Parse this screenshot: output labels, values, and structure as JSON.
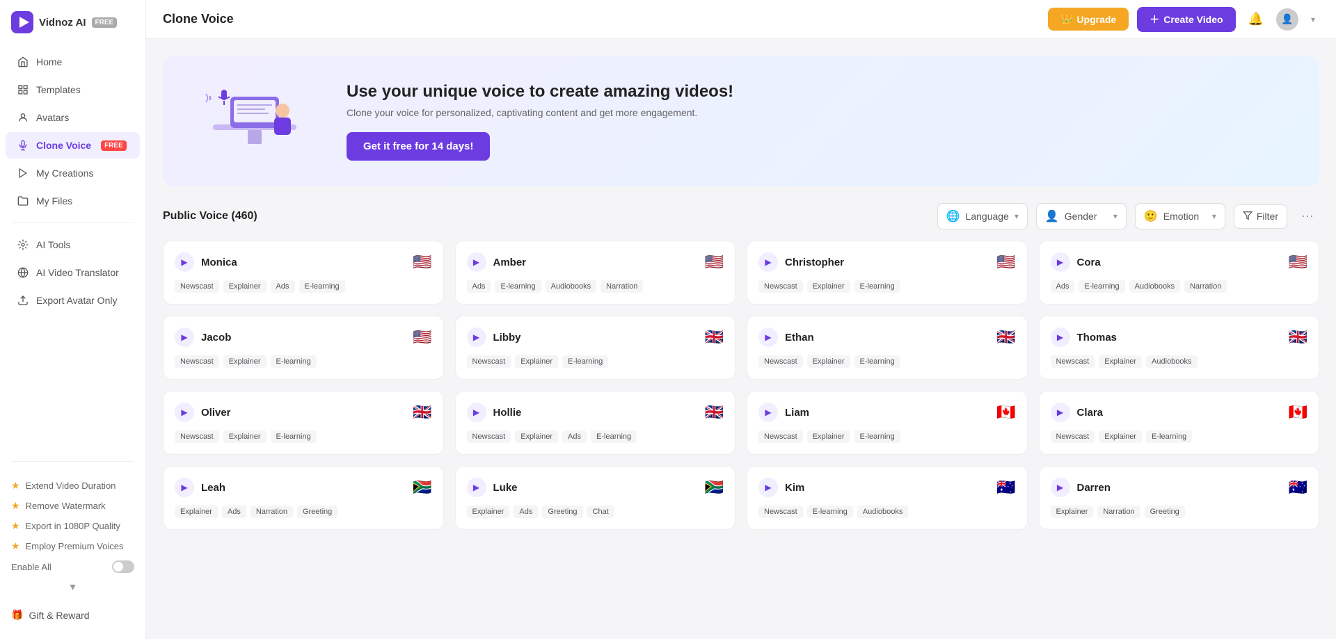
{
  "app": {
    "name": "Vidnoz AI",
    "badge": "FREE"
  },
  "topbar": {
    "title": "Clone Voice",
    "upgrade_label": "Upgrade",
    "create_label": "Create Video"
  },
  "sidebar": {
    "nav_items": [
      {
        "id": "home",
        "label": "Home",
        "icon": "home-icon",
        "active": false
      },
      {
        "id": "templates",
        "label": "Templates",
        "icon": "templates-icon",
        "active": false
      },
      {
        "id": "avatars",
        "label": "Avatars",
        "icon": "avatars-icon",
        "active": false
      },
      {
        "id": "clone-voice",
        "label": "Clone Voice",
        "icon": "clone-voice-icon",
        "active": true,
        "badge": "FREE"
      },
      {
        "id": "my-creations",
        "label": "My Creations",
        "icon": "creations-icon",
        "active": false
      },
      {
        "id": "my-files",
        "label": "My Files",
        "icon": "files-icon",
        "active": false
      }
    ],
    "tools_items": [
      {
        "id": "ai-tools",
        "label": "AI Tools",
        "icon": "ai-tools-icon"
      },
      {
        "id": "ai-video-translator",
        "label": "AI Video Translator",
        "icon": "translate-icon"
      },
      {
        "id": "export-avatar-only",
        "label": "Export Avatar Only",
        "icon": "export-icon"
      }
    ],
    "upgrade_items": [
      {
        "id": "extend-video",
        "label": "Extend Video Duration"
      },
      {
        "id": "remove-watermark",
        "label": "Remove Watermark"
      },
      {
        "id": "export-1080p",
        "label": "Export in 1080P Quality"
      },
      {
        "id": "premium-voices",
        "label": "Employ Premium Voices"
      }
    ],
    "enable_all_label": "Enable All",
    "gift_label": "Gift & Reward"
  },
  "banner": {
    "heading": "Use your unique voice to create amazing videos!",
    "subtext": "Clone your voice for personalized, captivating content and get more engagement.",
    "cta_label": "Get it free for 14 days!"
  },
  "voice_section": {
    "title": "Public Voice (460)",
    "filters": {
      "language_label": "Language",
      "gender_label": "Gender",
      "emotion_label": "Emotion",
      "filter_label": "Filter"
    }
  },
  "voices": [
    {
      "name": "Monica",
      "flag": "🇺🇸",
      "tags": [
        "Newscast",
        "Explainer",
        "Ads",
        "E-learning"
      ]
    },
    {
      "name": "Amber",
      "flag": "🇺🇸",
      "tags": [
        "Ads",
        "E-learning",
        "Audiobooks",
        "Narration"
      ]
    },
    {
      "name": "Christopher",
      "flag": "🇺🇸",
      "tags": [
        "Newscast",
        "Explainer",
        "E-learning"
      ]
    },
    {
      "name": "Cora",
      "flag": "🇺🇸",
      "tags": [
        "Ads",
        "E-learning",
        "Audiobooks",
        "Narration"
      ]
    },
    {
      "name": "Jacob",
      "flag": "🇺🇸",
      "tags": [
        "Newscast",
        "Explainer",
        "E-learning"
      ]
    },
    {
      "name": "Libby",
      "flag": "🇬🇧",
      "tags": [
        "Newscast",
        "Explainer",
        "E-learning"
      ]
    },
    {
      "name": "Ethan",
      "flag": "🇬🇧",
      "tags": [
        "Newscast",
        "Explainer",
        "E-learning"
      ]
    },
    {
      "name": "Thomas",
      "flag": "🇬🇧",
      "tags": [
        "Newscast",
        "Explainer",
        "Audiobooks"
      ]
    },
    {
      "name": "Oliver",
      "flag": "🇬🇧",
      "tags": [
        "Newscast",
        "Explainer",
        "E-learning"
      ]
    },
    {
      "name": "Hollie",
      "flag": "🇬🇧",
      "tags": [
        "Newscast",
        "Explainer",
        "Ads",
        "E-learning"
      ]
    },
    {
      "name": "Liam",
      "flag": "🇨🇦",
      "tags": [
        "Newscast",
        "Explainer",
        "E-learning"
      ]
    },
    {
      "name": "Clara",
      "flag": "🇨🇦",
      "tags": [
        "Newscast",
        "Explainer",
        "E-learning"
      ]
    },
    {
      "name": "Leah",
      "flag": "🇿🇦",
      "tags": [
        "Explainer",
        "Ads",
        "Narration",
        "Greeting"
      ]
    },
    {
      "name": "Luke",
      "flag": "🇿🇦",
      "tags": [
        "Explainer",
        "Ads",
        "Greeting",
        "Chat"
      ]
    },
    {
      "name": "Kim",
      "flag": "🇦🇺",
      "tags": [
        "Newscast",
        "E-learning",
        "Audiobooks"
      ]
    },
    {
      "name": "Darren",
      "flag": "🇦🇺",
      "tags": [
        "Explainer",
        "Narration",
        "Greeting"
      ]
    }
  ]
}
